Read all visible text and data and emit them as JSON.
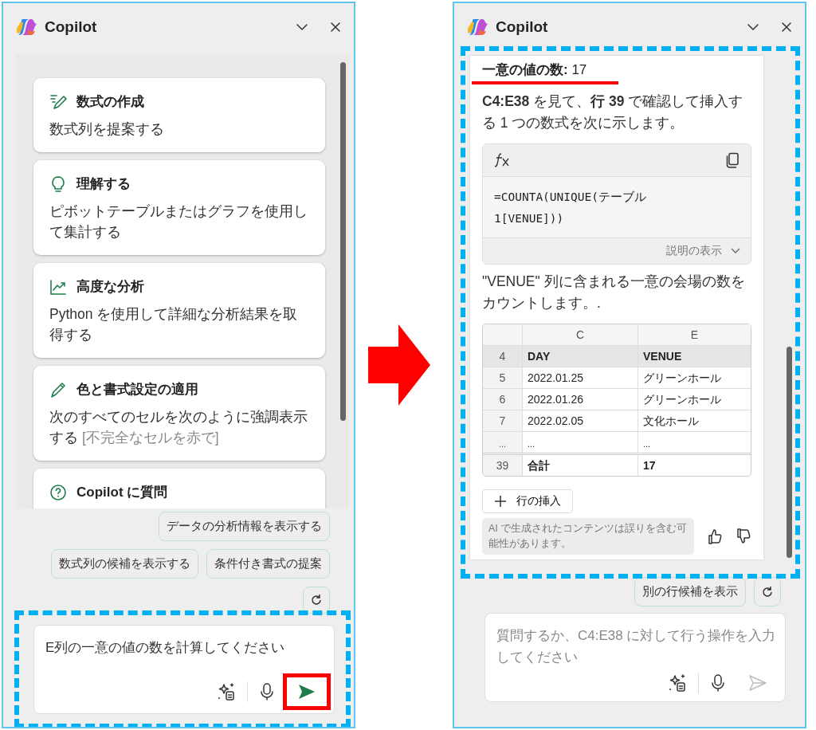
{
  "panels": [
    {
      "title": "Copilot",
      "content": {
        "kind": "suggestions",
        "cards": [
          {
            "kind": "formula",
            "title": "数式の作成",
            "text": "数式列を提案する"
          },
          {
            "kind": "bulb",
            "title": "理解する",
            "text": "ピボットテーブルまたはグラフを使用して集計する"
          },
          {
            "kind": "chart",
            "title": "高度な分析",
            "text": "Python を使用して詳細な分析結果を取得する"
          },
          {
            "kind": "pencil",
            "title": "色と書式設定の適用",
            "text": "次のすべてのセルを次のように強調表示する",
            "hint": "[不完全なセルを赤で]"
          },
          {
            "kind": "question",
            "title": "Copilot に質問"
          }
        ]
      },
      "chips": [
        [
          "データの分析情報を表示する"
        ],
        [
          "数式列の候補を表示する",
          "条件付き書式の提案"
        ]
      ],
      "composer": {
        "value": "E列の一意の値の数を計算してください",
        "highlighted": true,
        "send_enabled": true,
        "send_highlighted": true
      }
    },
    {
      "title": "Copilot",
      "content": {
        "kind": "response",
        "highlighted": true,
        "heading": "**一意の値の数:** 17",
        "heading_underlined": true,
        "intro": "**C4:E38** を見て、**行 39** で確認して挿入する 1 つの数式を次に示します。",
        "formula": "=COUNTA(UNIQUE(テーブル1[VENUE]))",
        "explain": "説明の表示",
        "description": "\"VENUE\" 列に含まれる一意の会場の数をカウントします。.",
        "table": {
          "columns": [
            "C",
            "E"
          ],
          "rows": [
            {
              "kind": "header",
              "row": "4",
              "cells": [
                "DAY",
                "VENUE"
              ]
            },
            {
              "kind": "data",
              "row": "5",
              "cells": [
                "2022.01.25",
                "グリーンホール"
              ]
            },
            {
              "kind": "data",
              "row": "6",
              "cells": [
                "2022.01.26",
                "グリーンホール"
              ]
            },
            {
              "kind": "data",
              "row": "7",
              "cells": [
                "2022.02.05",
                "文化ホール"
              ]
            },
            {
              "kind": "gap",
              "row": "...",
              "cells": [
                "...",
                "..."
              ]
            },
            {
              "kind": "total",
              "row": "39",
              "cells": [
                "合計",
                "17"
              ]
            }
          ]
        },
        "insert": "行の挿入",
        "disclaimer": "AI で生成されたコンテンツは誤りを含む可能性があります。"
      },
      "chips": [
        [
          "別の行候補を表示"
        ]
      ],
      "composer": {
        "placeholder": "質問するか、C4:E38 に対して行う操作を入力してください",
        "highlighted": false,
        "send_enabled": false,
        "send_highlighted": false
      }
    }
  ],
  "transition": {
    "kind": "arrow"
  }
}
